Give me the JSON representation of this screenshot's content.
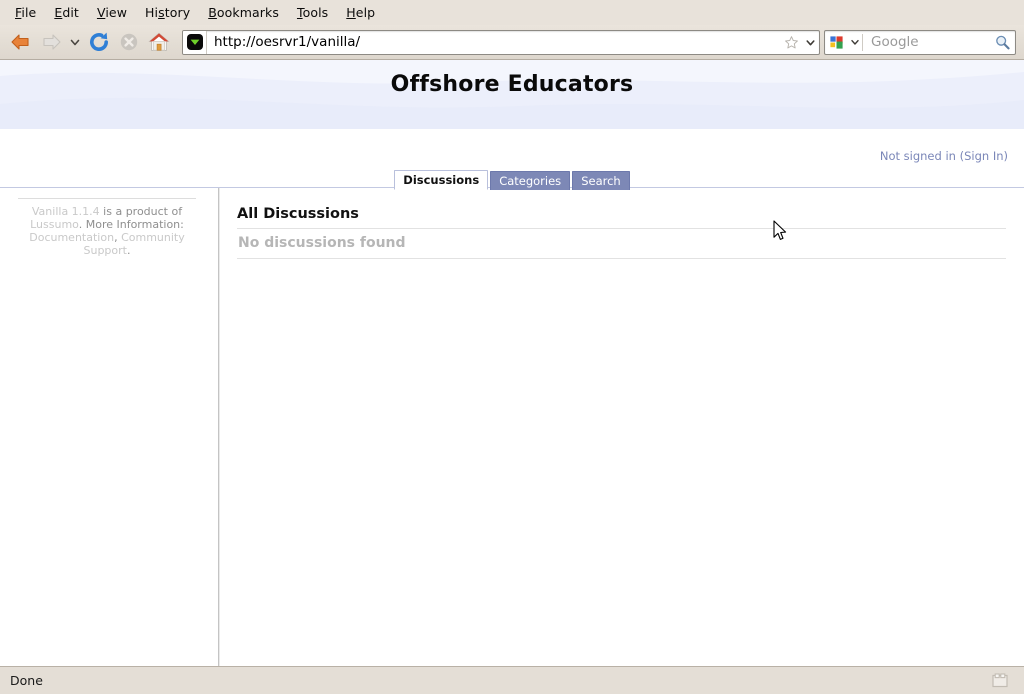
{
  "browser": {
    "menu": [
      {
        "label": "File",
        "accel": "F"
      },
      {
        "label": "Edit",
        "accel": "E"
      },
      {
        "label": "View",
        "accel": "V"
      },
      {
        "label": "History",
        "accel": "s"
      },
      {
        "label": "Bookmarks",
        "accel": "B"
      },
      {
        "label": "Tools",
        "accel": "T"
      },
      {
        "label": "Help",
        "accel": "H"
      }
    ],
    "toolbar": {
      "back_icon": "back-arrow-icon",
      "forward_icon": "forward-arrow-icon",
      "history_dropdown_icon": "chevron-down-icon",
      "reload_icon": "reload-icon",
      "stop_icon": "stop-icon",
      "home_icon": "home-icon"
    },
    "address_bar": {
      "url": "http://oesrvr1/vanilla/",
      "favicon": "vanilla-chevron-favicon",
      "bookmark_icon": "star-icon",
      "dropdown_icon": "chevron-down-icon"
    },
    "search_bar": {
      "engine": "Google",
      "engine_icon": "google-icon",
      "placeholder": "Google",
      "dropdown_icon": "chevron-down-icon",
      "go_icon": "search-icon"
    },
    "status": {
      "text": "Done",
      "grip_icon": "resize-grip-icon"
    }
  },
  "page": {
    "title": "Offshore Educators",
    "account": {
      "status_text": "Not signed in (",
      "sign_in_label": "Sign In",
      "status_suffix": ")"
    },
    "tabs": [
      {
        "label": "Discussions",
        "active": true
      },
      {
        "label": "Categories",
        "active": false
      },
      {
        "label": "Search",
        "active": false
      }
    ],
    "sidebar": {
      "footer": {
        "product_link": "Vanilla 1.1.4",
        "text_1": " is a product of ",
        "vendor_link": "Lussumo",
        "text_2": ". ",
        "more_info_label": "More Information:",
        "text_3": " ",
        "doc_link": "Documentation",
        "separator": ", ",
        "support_link": "Community Support",
        "text_4": "."
      }
    },
    "content": {
      "heading": "All Discussions",
      "empty_message": "No discussions found"
    }
  },
  "colors": {
    "header_bg": "#eceffb",
    "tab_inactive": "#7d88b6",
    "link_blue": "#7b87b8",
    "chrome_bg": "#e8e2da",
    "status_bg": "#e4ded6"
  }
}
